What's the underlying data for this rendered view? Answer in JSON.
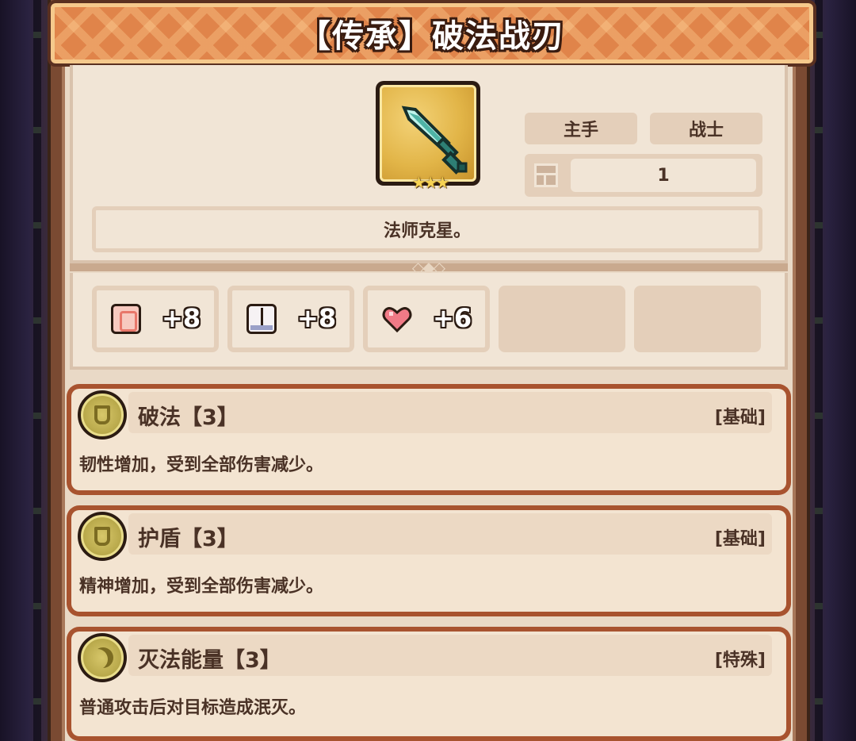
{
  "title": "【传承】破法战刃",
  "item": {
    "icon": "dagger-icon",
    "stars": "★★★",
    "slot": "主手",
    "class": "战士",
    "level": "1",
    "description": "法师克星。"
  },
  "stats": [
    {
      "icon": "strength-icon",
      "value": "+8"
    },
    {
      "icon": "spellbook-icon",
      "value": "+8"
    },
    {
      "icon": "heart-icon",
      "value": "+6"
    }
  ],
  "skills": [
    {
      "icon": "shield-icon",
      "name": "破法【3】",
      "type": "[基础]",
      "desc": "韧性增加，受到全部伤害减少。"
    },
    {
      "icon": "shield-icon",
      "name": "护盾【3】",
      "type": "[基础]",
      "desc": "精神增加，受到全部伤害减少。"
    },
    {
      "icon": "moon-icon",
      "name": "灭法能量【3】",
      "type": "[特殊]",
      "desc": "普通攻击后对目标造成泯灭。"
    }
  ],
  "colors": {
    "banner": "#e0844a",
    "panel": "#f1e5d6",
    "skill_border": "#a8532f",
    "text": "#4a3226"
  }
}
